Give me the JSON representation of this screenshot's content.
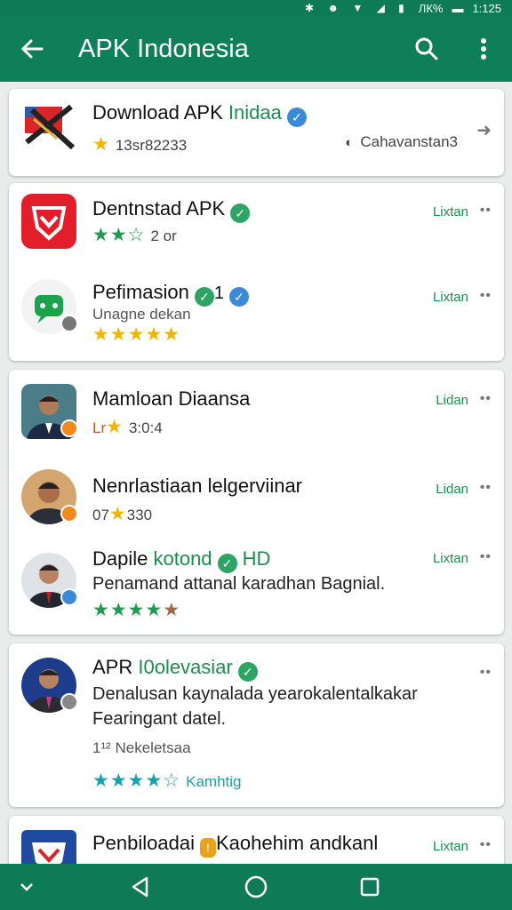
{
  "status": {
    "time": "1:125",
    "battery_text": "ЛК%"
  },
  "appbar": {
    "title": "APK Indonesia",
    "back_icon": "arrow-left-icon",
    "search_icon": "search-icon",
    "menu_icon": "more-vert-icon"
  },
  "cards": {
    "c1": {
      "title_a": "Download APK ",
      "title_b": "Inidaa",
      "meta": "13sr82233",
      "side": "Cahavanstan3"
    },
    "c2": [
      {
        "title": "Dentnstad APK",
        "rating_meta": "2 or",
        "side": "Lixtan"
      },
      {
        "title": "Pefimasion",
        "badge_text": "1",
        "subtitle": "Unagne dekan",
        "side": "Lixtan"
      }
    ],
    "c3": [
      {
        "title": "Mamloan Diaansa",
        "meta_prefix": "Lr",
        "meta": "3:0:4",
        "side": "Lidan"
      },
      {
        "title": "Nenrlastiaan lelgerviinar",
        "meta_prefix": "07",
        "meta": "330",
        "side": "Lidan"
      },
      {
        "title_a": "Dapile ",
        "title_b": "kotond",
        "title_c": "HD",
        "description": "Penamand attanal karadhan Bagnial.",
        "side": "Lixtan"
      }
    ],
    "c4": {
      "title_a": "APR ",
      "title_b": "I0olevasiar",
      "description_1": "Denalusan kaynalada yearokalentalkakar",
      "description_2": "Fearingant datel.",
      "meta": "1¹² Nekeletsaa",
      "rating_text": "Kamhtig"
    },
    "c5": {
      "title_a": "Penbiloadai",
      "title_b": "Kaohehim andkanl",
      "side": "Lixtan"
    }
  },
  "colors": {
    "primary": "#0f7f5a",
    "accent_green": "#1d8d4f",
    "star": "#f2b400",
    "star_green": "#1f9a4d",
    "star_teal": "#1aa0a8"
  }
}
